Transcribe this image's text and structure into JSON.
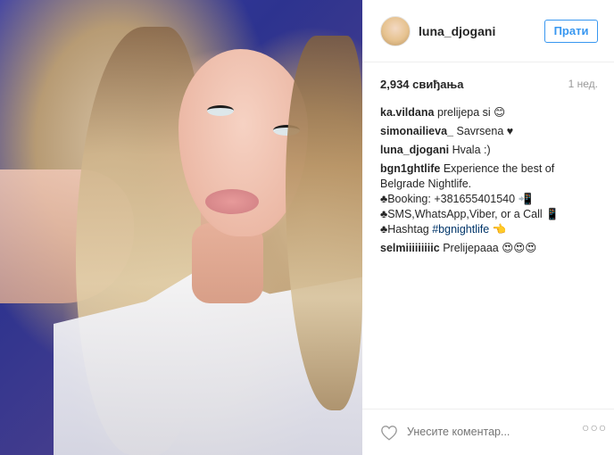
{
  "post": {
    "username": "luna_djogani",
    "follow_label": "Прати",
    "likes": "2,934 свиђања",
    "time": "1 нед."
  },
  "comments": [
    {
      "user": "ka.vildana",
      "text": "prelijepa si 😊"
    },
    {
      "user": "simonailieva_",
      "text": "Savrsena ♥"
    },
    {
      "user": "luna_djogani",
      "text": "Hvala :)"
    },
    {
      "user": "bgn1ghtlife",
      "lines": [
        "Experience the best of Belgrade Nightlife.",
        "♣Booking: +381655401540 📲",
        "♣SMS,WhatsApp,Viber, or a Call 📱"
      ],
      "hashtag_prefix": "♣Hashtag ",
      "hashtag": "#bgnightlife",
      "hashtag_suffix": " 👈"
    },
    {
      "user": "selmiiiiiiiiic",
      "text": "Prelijepaaa 😍😍😍"
    }
  ],
  "footer": {
    "comment_placeholder": "Унесите коментар...",
    "more_label": "○○○"
  },
  "icons": {
    "heart": "heart-outline-icon",
    "more": "more-options-icon"
  },
  "colors": {
    "accent": "#3897f0",
    "hashtag": "#003569"
  }
}
